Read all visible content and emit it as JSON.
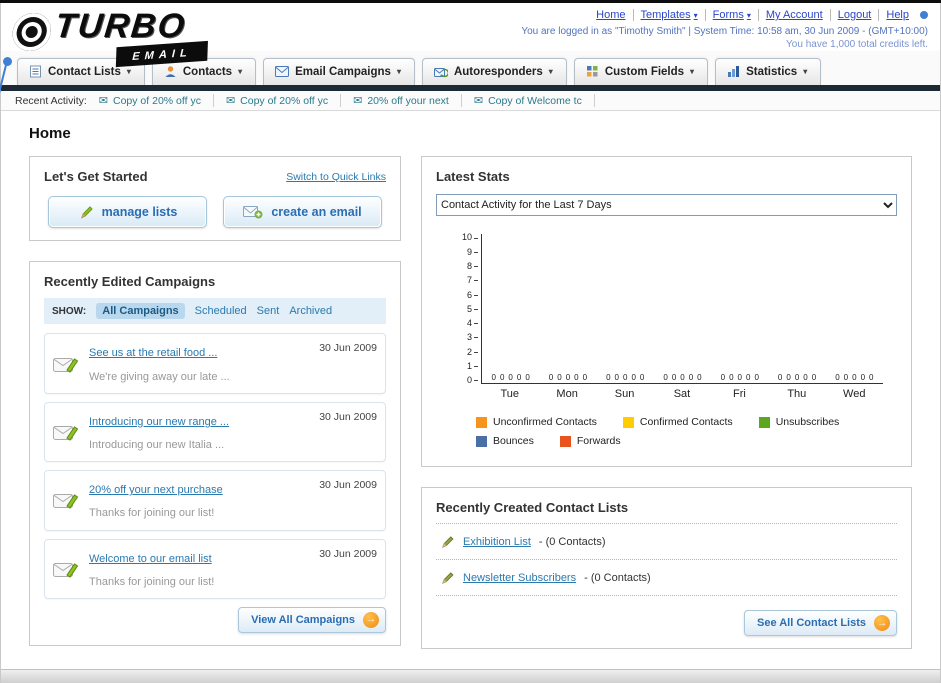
{
  "icons": {
    "caret": "▾",
    "arrow": "→",
    "envelope": "✉",
    "pencil": "✎"
  },
  "header": {
    "logo": {
      "title": "TURBO",
      "subtitle": "EMAIL"
    },
    "links": [
      {
        "label": "Home"
      },
      {
        "label": "Templates",
        "has_menu": true
      },
      {
        "label": "Forms",
        "has_menu": true
      },
      {
        "label": "My Account"
      },
      {
        "label": "Logout"
      },
      {
        "label": "Help"
      }
    ],
    "login_status": "You are logged in as \"Timothy Smith\" | System Time: 10:58 am, 30 Jun 2009 - (GMT+10:00)",
    "credits": "You have 1,000 total credits left."
  },
  "nav": {
    "items": [
      {
        "label": "Contact Lists"
      },
      {
        "label": "Contacts"
      },
      {
        "label": "Email Campaigns"
      },
      {
        "label": "Autoresponders"
      },
      {
        "label": "Custom Fields"
      },
      {
        "label": "Statistics"
      }
    ]
  },
  "recent_activity": {
    "label": "Recent Activity:",
    "items": [
      {
        "text": "Copy of 20% off yc"
      },
      {
        "text": "Copy of 20% off yc"
      },
      {
        "text": "20% off your next"
      },
      {
        "text": "Copy of Welcome tc"
      }
    ]
  },
  "page_title": "Home",
  "get_started": {
    "title": "Let's Get Started",
    "switch_link": "Switch to Quick Links",
    "buttons": [
      {
        "label": "manage lists"
      },
      {
        "label": "create an email"
      }
    ]
  },
  "campaigns": {
    "title": "Recently Edited Campaigns",
    "show_label": "SHOW:",
    "tabs": [
      {
        "label": "All Campaigns",
        "selected": true
      },
      {
        "label": "Scheduled",
        "selected": false
      },
      {
        "label": "Sent",
        "selected": false
      },
      {
        "label": "Archived",
        "selected": false
      }
    ],
    "items": [
      {
        "title": "See us at the retail food ...",
        "subtitle": "We're giving away our late ...",
        "date": "30 Jun 2009"
      },
      {
        "title": "Introducing our new range ...",
        "subtitle": "Introducing our new Italia ...",
        "date": "30 Jun 2009"
      },
      {
        "title": "20% off your next purchase",
        "subtitle": "Thanks for joining our list!",
        "date": "30 Jun 2009"
      },
      {
        "title": "Welcome to our email list",
        "subtitle": "Thanks for joining our list!",
        "date": "30 Jun 2009"
      }
    ],
    "view_all_label": "View All Campaigns"
  },
  "stats": {
    "title": "Latest Stats",
    "dropdown_value": "Contact Activity for the Last 7 Days",
    "chart_data": {
      "type": "bar",
      "title": "Contact Activity for the Last 7 Days",
      "categories": [
        "Tue",
        "Mon",
        "Sun",
        "Sat",
        "Fri",
        "Thu",
        "Wed"
      ],
      "series": [
        {
          "name": "Unconfirmed Contacts",
          "color": "#F7941E",
          "values": [
            0,
            0,
            0,
            0,
            0,
            0,
            0
          ]
        },
        {
          "name": "Confirmed Contacts",
          "color": "#FFCC00",
          "values": [
            0,
            0,
            0,
            0,
            0,
            0,
            0
          ]
        },
        {
          "name": "Unsubscribes",
          "color": "#5BA81E",
          "values": [
            0,
            0,
            0,
            0,
            0,
            0,
            0
          ]
        },
        {
          "name": "Bounces",
          "color": "#4A6FA5",
          "values": [
            0,
            0,
            0,
            0,
            0,
            0,
            0
          ]
        },
        {
          "name": "Forwards",
          "color": "#E8541D",
          "values": [
            0,
            0,
            0,
            0,
            0,
            0,
            0
          ]
        }
      ],
      "xlabel": "",
      "ylabel": "",
      "ylim": [
        0,
        10
      ],
      "yticks": [
        10,
        9,
        8,
        7,
        6,
        5,
        4,
        3,
        2,
        1,
        0
      ],
      "grid": false,
      "legend_position": "bottom",
      "data_labels": true
    }
  },
  "contact_lists": {
    "title": "Recently Created Contact Lists",
    "items": [
      {
        "name": "Exhibition List",
        "detail": "- (0 Contacts)"
      },
      {
        "name": "Newsletter Subscribers",
        "detail": "- (0 Contacts)"
      }
    ],
    "see_all_label": "See All Contact Lists"
  }
}
